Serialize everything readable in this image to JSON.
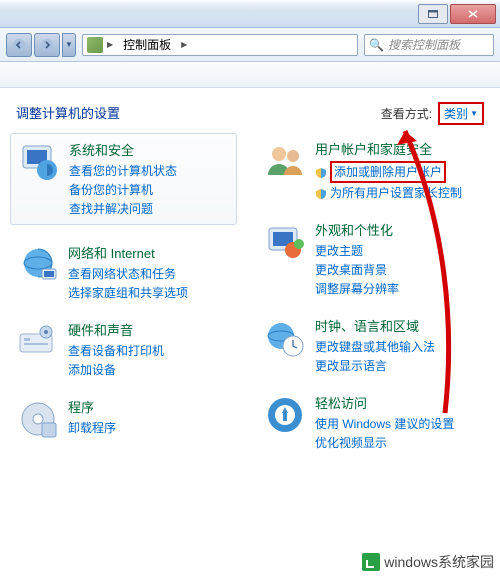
{
  "address": {
    "crumb": "控制面板"
  },
  "search": {
    "placeholder": "搜索控制面板"
  },
  "heading": "调整计算机的设置",
  "view": {
    "label": "查看方式:",
    "value": "类别"
  },
  "left": [
    {
      "title": "系统和安全",
      "links": [
        {
          "t": "查看您的计算机状态"
        },
        {
          "t": "备份您的计算机"
        },
        {
          "t": "查找并解决问题"
        }
      ]
    },
    {
      "title": "网络和 Internet",
      "links": [
        {
          "t": "查看网络状态和任务"
        },
        {
          "t": "选择家庭组和共享选项"
        }
      ]
    },
    {
      "title": "硬件和声音",
      "links": [
        {
          "t": "查看设备和打印机"
        },
        {
          "t": "添加设备"
        }
      ]
    },
    {
      "title": "程序",
      "links": [
        {
          "t": "卸载程序"
        }
      ]
    }
  ],
  "right": [
    {
      "title": "用户帐户和家庭安全",
      "links": [
        {
          "t": "添加或删除用户帐户",
          "shield": true,
          "red": true
        },
        {
          "t": "为所有用户设置家长控制",
          "shield": true
        }
      ]
    },
    {
      "title": "外观和个性化",
      "links": [
        {
          "t": "更改主题"
        },
        {
          "t": "更改桌面背景"
        },
        {
          "t": "调整屏幕分辨率"
        }
      ]
    },
    {
      "title": "时钟、语言和区域",
      "links": [
        {
          "t": "更改键盘或其他输入法"
        },
        {
          "t": "更改显示语言"
        }
      ]
    },
    {
      "title": "轻松访问",
      "links": [
        {
          "t": "使用 Windows 建议的设置"
        },
        {
          "t": "优化视频显示"
        }
      ]
    }
  ],
  "watermark": "windows系统家园"
}
